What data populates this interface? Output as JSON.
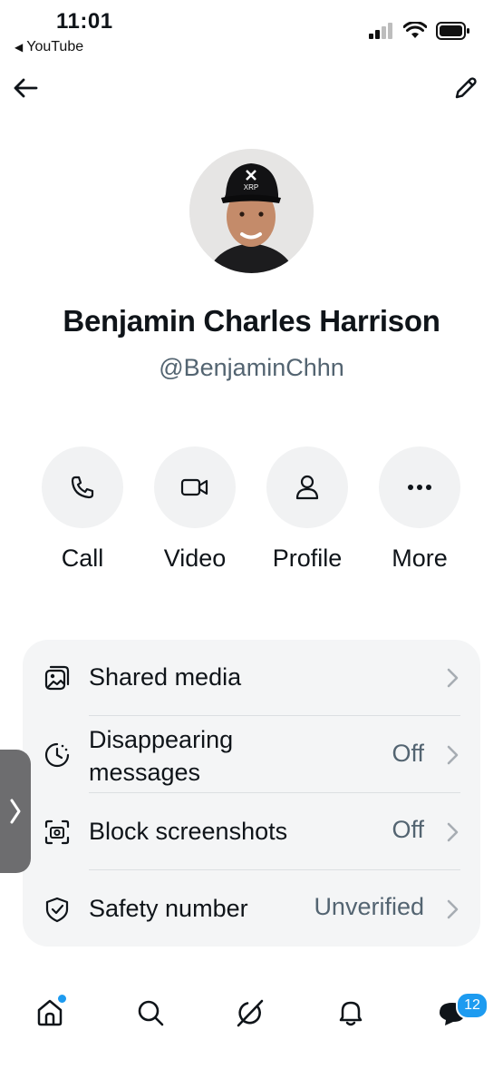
{
  "status_bar": {
    "time": "11:01",
    "back_app": "YouTube"
  },
  "profile": {
    "name": "Benjamin Charles Harrison",
    "handle": "@BenjaminChhn",
    "cap_text": "XRP"
  },
  "actions": [
    {
      "label": "Call",
      "icon": "phone-icon"
    },
    {
      "label": "Video",
      "icon": "video-camera-icon"
    },
    {
      "label": "Profile",
      "icon": "person-icon"
    },
    {
      "label": "More",
      "icon": "more-dots-icon"
    }
  ],
  "settings": [
    {
      "label": "Shared media",
      "value": "",
      "icon": "shared-media-icon"
    },
    {
      "label_line1": "Disappearing",
      "label_line2": "messages",
      "value": "Off",
      "icon": "timer-icon"
    },
    {
      "label": "Block screenshots",
      "value": "Off",
      "icon": "screenshot-block-icon"
    },
    {
      "label": "Safety number",
      "value": "Unverified",
      "icon": "shield-check-icon"
    }
  ],
  "bottom_nav": {
    "messages_badge": "12"
  },
  "colors": {
    "accent": "#1d9bf0",
    "text": "#0f1419",
    "muted": "#536471",
    "card": "#f4f5f6"
  }
}
